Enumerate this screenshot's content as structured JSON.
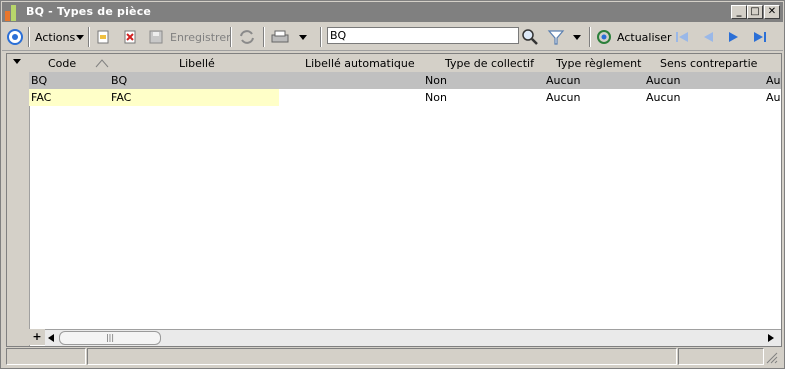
{
  "window": {
    "title": "BQ -  Types de pièce",
    "minimize_label": "_",
    "maximize_label": "□",
    "close_label": "✕"
  },
  "toolbar": {
    "actions_label": "Actions",
    "save_label": "Enregistrer",
    "search_value": "BQ",
    "refresh_label": "Actualiser"
  },
  "grid": {
    "columns": [
      "Code",
      "Libellé",
      "Libellé automatique",
      "Type de collectif",
      "Type règlement",
      "Sens contrepartie"
    ],
    "rows": [
      {
        "code": "BQ",
        "libelle": "BQ",
        "libelle_auto": "",
        "type_collectif": "Non",
        "type_reglement": "Aucun",
        "sens": "Aucun",
        "extra": "Au"
      },
      {
        "code": "FAC",
        "libelle": "FAC",
        "libelle_auto": "",
        "type_collectif": "Non",
        "type_reglement": "Aucun",
        "sens": "Aucun",
        "extra": "Au"
      }
    ],
    "add_row_label": "+",
    "scroll_thumb_label": "|||"
  },
  "colors": {
    "selected_row": "#c0c0c0",
    "edit_cell": "#ffffc8",
    "accent_blue": "#2b6fd6"
  }
}
